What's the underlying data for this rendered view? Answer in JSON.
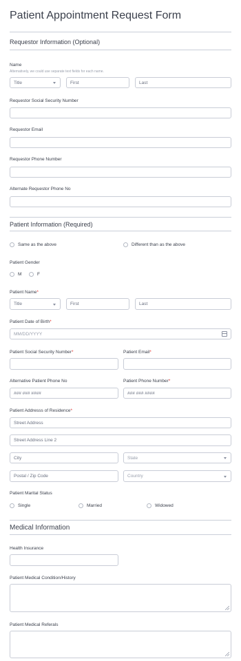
{
  "form": {
    "title": "Patient Appointment Request Form",
    "requestor_section": "Requestor Information (Optional)",
    "name_label": "Name",
    "name_hint": "Alternatively, we could use separate text fields for each name.",
    "title_select": "Title",
    "first_placeholder": "First",
    "last_placeholder": "Last",
    "req_ssn_label": "Requestor Social Security Number",
    "req_email_label": "Requestor Email",
    "req_phone_label": "Requestor Phone Number",
    "alt_req_phone_label": "Alternate Requestor Phone No",
    "patient_section": "Patient Information (Required)",
    "same_option": "Same as the above",
    "different_option": "Different than as the above",
    "gender_label": "Patient Gender",
    "gender_m": "M",
    "gender_f": "F",
    "patient_name_label": "Patient Name",
    "patient_title_select": "Title",
    "patient_first_placeholder": "First",
    "patient_last_placeholder": "Last",
    "dob_label": "Patient Date of Birth",
    "dob_placeholder": "MM/DD/YYYY",
    "patient_ssn_label": "Patient Social Security Number",
    "patient_email_label": "Patient Email",
    "alt_patient_phone_label": "Alternative Patient Phone No",
    "patient_phone_label": "Patient Phone Number",
    "alt_phone_placeholder": "### ### ####",
    "phone_placeholder": "### ### ####",
    "address_label": "Patient Addresss of Residence",
    "street_placeholder": "Street Address",
    "street2_placeholder": "Street Address Line 2",
    "city_placeholder": "City",
    "state_select": "State",
    "postal_placeholder": "Postal / Zip Code",
    "country_select": "Country",
    "marital_label": "Patient Marital Status",
    "marital_single": "Single",
    "marital_married": "Married",
    "marital_widowed": "Widowed",
    "medical_section": "Medical Information",
    "insurance_label": "Health Insurance",
    "condition_label": "Patient Medical Condition/History",
    "referrals_label": "Patient Medical Referals",
    "required_mark": "*"
  },
  "colors": {
    "required": "#e2312d",
    "border": "#c8ccd6",
    "text": "#3a3f4b"
  },
  "icons": [
    "caret-down-icon",
    "calendar-icon",
    "resize-grip-icon"
  ]
}
